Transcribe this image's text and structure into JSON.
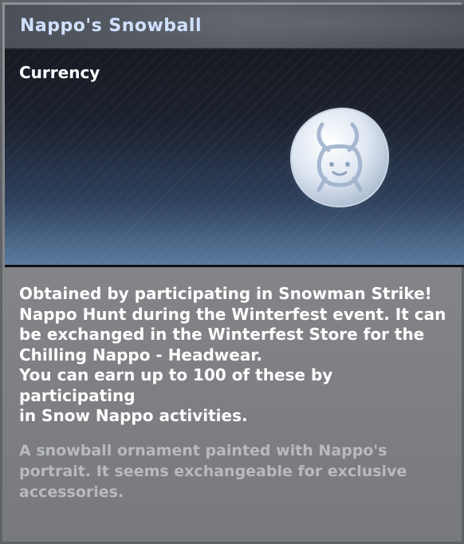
{
  "item": {
    "name": "Nappo's Snowball",
    "category": "Currency",
    "icon": "snowball-nappo-icon",
    "description_lines": [
      "Obtained by participating in Snowman Strike!",
      "Nappo Hunt during the Winterfest event. It can",
      "be exchanged in the Winterfest Store for the",
      "Chilling Nappo - Headwear.",
      "You can earn up to 100 of these by participating",
      "in Snow Nappo activities."
    ],
    "flavor_lines": [
      "A snowball ornament painted with Nappo's",
      "portrait. It seems exchangeable for exclusive",
      "accessories."
    ]
  },
  "colors": {
    "title": "#cfe0ff",
    "description": "#ffffff",
    "flavor": "#b8babd"
  }
}
